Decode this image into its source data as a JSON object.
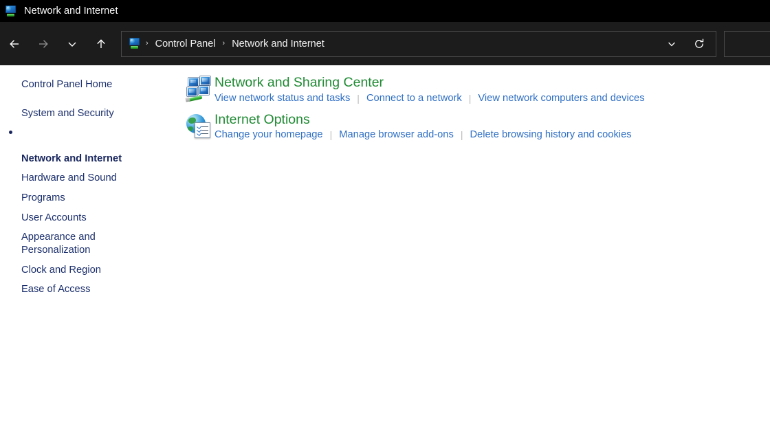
{
  "titlebar": {
    "title": "Network and Internet",
    "icon": "control-panel-network-icon"
  },
  "toolbar": {
    "back": "←",
    "forward": "→",
    "recent_locations": "⌄",
    "up": "↑",
    "address_icon": "control-panel-network-icon",
    "breadcrumbs": [
      {
        "label": "Control Panel"
      },
      {
        "label": "Network and Internet"
      }
    ],
    "breadcrumb_separator": "›",
    "dropdown": "chevron-down-icon",
    "refresh": "refresh-icon",
    "search_value": "",
    "search_placeholder": ""
  },
  "sidebar": {
    "home": {
      "label": "Control Panel Home"
    },
    "items": [
      {
        "label": "System and Security",
        "selected": false
      },
      {
        "label": "Network and Internet",
        "selected": true
      },
      {
        "label": "Hardware and Sound",
        "selected": false
      },
      {
        "label": "Programs",
        "selected": false
      },
      {
        "label": "User Accounts",
        "selected": false
      },
      {
        "label": "Appearance and\nPersonalization",
        "selected": false
      },
      {
        "label": "Clock and Region",
        "selected": false
      },
      {
        "label": "Ease of Access",
        "selected": false
      }
    ]
  },
  "main": {
    "sections": [
      {
        "icon": "network-and-sharing-center-icon",
        "title": "Network and Sharing Center",
        "links": [
          "View network status and tasks",
          "Connect to a network",
          "View network computers and devices"
        ]
      },
      {
        "icon": "internet-options-icon",
        "title": "Internet Options",
        "links": [
          "Change your homepage",
          "Manage browser add-ons",
          "Delete browsing history and cookies"
        ]
      }
    ]
  },
  "colors": {
    "titlebar_bg": "#000000",
    "toolbar_bg": "#1c1c1c",
    "content_bg": "#ffffff",
    "sidebar_text": "#1b2f6b",
    "section_title": "#1f8a33",
    "link": "#2f6fc4"
  }
}
